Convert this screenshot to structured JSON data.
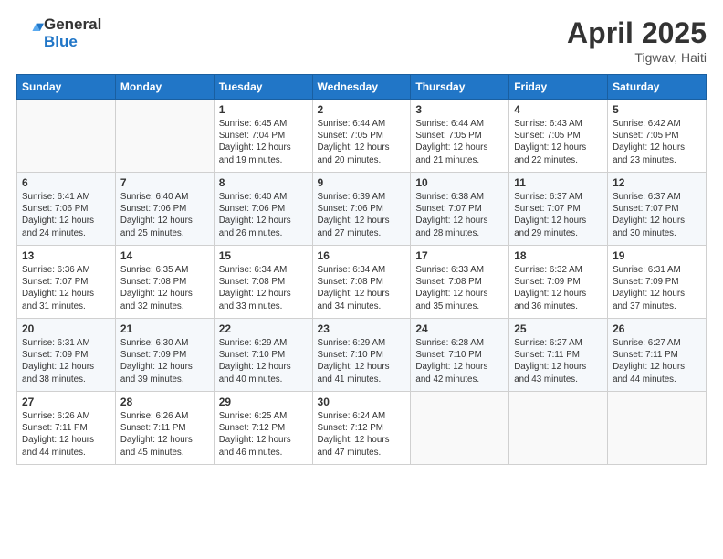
{
  "header": {
    "logo_line1": "General",
    "logo_line2": "Blue",
    "month": "April 2025",
    "location": "Tigwav, Haiti"
  },
  "weekdays": [
    "Sunday",
    "Monday",
    "Tuesday",
    "Wednesday",
    "Thursday",
    "Friday",
    "Saturday"
  ],
  "weeks": [
    [
      {
        "day": "",
        "info": ""
      },
      {
        "day": "",
        "info": ""
      },
      {
        "day": "1",
        "info": "Sunrise: 6:45 AM\nSunset: 7:04 PM\nDaylight: 12 hours and 19 minutes."
      },
      {
        "day": "2",
        "info": "Sunrise: 6:44 AM\nSunset: 7:05 PM\nDaylight: 12 hours and 20 minutes."
      },
      {
        "day": "3",
        "info": "Sunrise: 6:44 AM\nSunset: 7:05 PM\nDaylight: 12 hours and 21 minutes."
      },
      {
        "day": "4",
        "info": "Sunrise: 6:43 AM\nSunset: 7:05 PM\nDaylight: 12 hours and 22 minutes."
      },
      {
        "day": "5",
        "info": "Sunrise: 6:42 AM\nSunset: 7:05 PM\nDaylight: 12 hours and 23 minutes."
      }
    ],
    [
      {
        "day": "6",
        "info": "Sunrise: 6:41 AM\nSunset: 7:06 PM\nDaylight: 12 hours and 24 minutes."
      },
      {
        "day": "7",
        "info": "Sunrise: 6:40 AM\nSunset: 7:06 PM\nDaylight: 12 hours and 25 minutes."
      },
      {
        "day": "8",
        "info": "Sunrise: 6:40 AM\nSunset: 7:06 PM\nDaylight: 12 hours and 26 minutes."
      },
      {
        "day": "9",
        "info": "Sunrise: 6:39 AM\nSunset: 7:06 PM\nDaylight: 12 hours and 27 minutes."
      },
      {
        "day": "10",
        "info": "Sunrise: 6:38 AM\nSunset: 7:07 PM\nDaylight: 12 hours and 28 minutes."
      },
      {
        "day": "11",
        "info": "Sunrise: 6:37 AM\nSunset: 7:07 PM\nDaylight: 12 hours and 29 minutes."
      },
      {
        "day": "12",
        "info": "Sunrise: 6:37 AM\nSunset: 7:07 PM\nDaylight: 12 hours and 30 minutes."
      }
    ],
    [
      {
        "day": "13",
        "info": "Sunrise: 6:36 AM\nSunset: 7:07 PM\nDaylight: 12 hours and 31 minutes."
      },
      {
        "day": "14",
        "info": "Sunrise: 6:35 AM\nSunset: 7:08 PM\nDaylight: 12 hours and 32 minutes."
      },
      {
        "day": "15",
        "info": "Sunrise: 6:34 AM\nSunset: 7:08 PM\nDaylight: 12 hours and 33 minutes."
      },
      {
        "day": "16",
        "info": "Sunrise: 6:34 AM\nSunset: 7:08 PM\nDaylight: 12 hours and 34 minutes."
      },
      {
        "day": "17",
        "info": "Sunrise: 6:33 AM\nSunset: 7:08 PM\nDaylight: 12 hours and 35 minutes."
      },
      {
        "day": "18",
        "info": "Sunrise: 6:32 AM\nSunset: 7:09 PM\nDaylight: 12 hours and 36 minutes."
      },
      {
        "day": "19",
        "info": "Sunrise: 6:31 AM\nSunset: 7:09 PM\nDaylight: 12 hours and 37 minutes."
      }
    ],
    [
      {
        "day": "20",
        "info": "Sunrise: 6:31 AM\nSunset: 7:09 PM\nDaylight: 12 hours and 38 minutes."
      },
      {
        "day": "21",
        "info": "Sunrise: 6:30 AM\nSunset: 7:09 PM\nDaylight: 12 hours and 39 minutes."
      },
      {
        "day": "22",
        "info": "Sunrise: 6:29 AM\nSunset: 7:10 PM\nDaylight: 12 hours and 40 minutes."
      },
      {
        "day": "23",
        "info": "Sunrise: 6:29 AM\nSunset: 7:10 PM\nDaylight: 12 hours and 41 minutes."
      },
      {
        "day": "24",
        "info": "Sunrise: 6:28 AM\nSunset: 7:10 PM\nDaylight: 12 hours and 42 minutes."
      },
      {
        "day": "25",
        "info": "Sunrise: 6:27 AM\nSunset: 7:11 PM\nDaylight: 12 hours and 43 minutes."
      },
      {
        "day": "26",
        "info": "Sunrise: 6:27 AM\nSunset: 7:11 PM\nDaylight: 12 hours and 44 minutes."
      }
    ],
    [
      {
        "day": "27",
        "info": "Sunrise: 6:26 AM\nSunset: 7:11 PM\nDaylight: 12 hours and 44 minutes."
      },
      {
        "day": "28",
        "info": "Sunrise: 6:26 AM\nSunset: 7:11 PM\nDaylight: 12 hours and 45 minutes."
      },
      {
        "day": "29",
        "info": "Sunrise: 6:25 AM\nSunset: 7:12 PM\nDaylight: 12 hours and 46 minutes."
      },
      {
        "day": "30",
        "info": "Sunrise: 6:24 AM\nSunset: 7:12 PM\nDaylight: 12 hours and 47 minutes."
      },
      {
        "day": "",
        "info": ""
      },
      {
        "day": "",
        "info": ""
      },
      {
        "day": "",
        "info": ""
      }
    ]
  ]
}
